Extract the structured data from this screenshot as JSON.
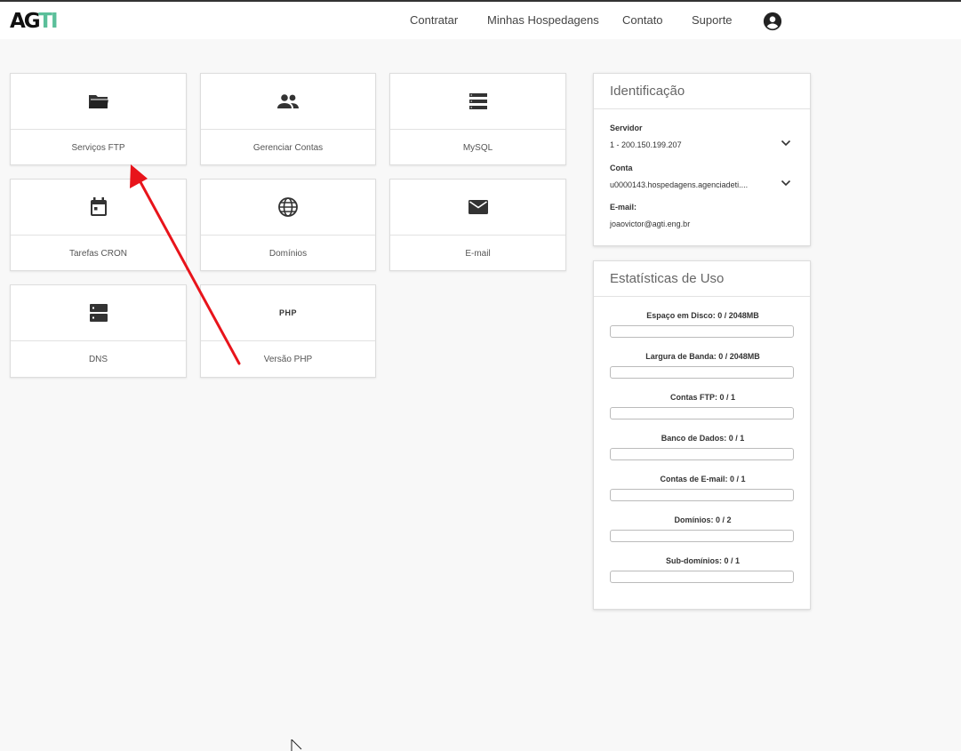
{
  "header": {
    "logo_ag": "AG",
    "logo_ti": "TI",
    "nav": [
      "Contratar",
      "Minhas Hospedagens",
      "Contato",
      "Suporte"
    ],
    "account_icon": "account-circle-icon"
  },
  "tiles": [
    {
      "label": "Serviços FTP",
      "icon": "folder-icon"
    },
    {
      "label": "Gerenciar Contas",
      "icon": "people-icon"
    },
    {
      "label": "MySQL",
      "icon": "list-icon"
    },
    {
      "label": "Tarefas CRON",
      "icon": "calendar-icon"
    },
    {
      "label": "Domínios",
      "icon": "globe-icon"
    },
    {
      "label": "E-mail",
      "icon": "mail-icon"
    },
    {
      "label": "DNS",
      "icon": "server-icon"
    },
    {
      "label": "Versão PHP",
      "icon": "php-icon",
      "icon_text": "PHP"
    }
  ],
  "identification": {
    "title": "Identificação",
    "server_label": "Servidor",
    "server_value": "1 - 200.150.199.207",
    "account_label": "Conta",
    "account_value": "u0000143.hospedagens.agenciadeti....",
    "email_label": "E-mail:",
    "email_value": "joaovictor@agti.eng.br"
  },
  "stats": {
    "title": "Estatísticas de Uso",
    "items": [
      {
        "label": "Espaço em Disco: 0 / 2048MB",
        "fraction": 0
      },
      {
        "label": "Largura de Banda: 0 / 2048MB",
        "fraction": 0
      },
      {
        "label": "Contas FTP: 0 / 1",
        "fraction": 0
      },
      {
        "label": "Banco de Dados: 0 / 1",
        "fraction": 0
      },
      {
        "label": "Contas de E-mail: 0 / 1",
        "fraction": 0
      },
      {
        "label": "Domínios: 0 / 2",
        "fraction": 0
      },
      {
        "label": "Sub-domínios: 0 / 1",
        "fraction": 0
      }
    ]
  },
  "colors": {
    "accent": "#5bbf9a",
    "annotation_arrow": "#e8141b"
  }
}
